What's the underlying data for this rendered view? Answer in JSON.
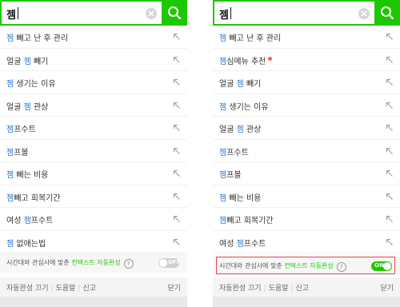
{
  "left": {
    "query": "젬",
    "suggestions": [
      {
        "hl": "젬",
        "rest": " 빼고 난 후 관리"
      },
      {
        "pre": "얼굴 ",
        "hl": "젬",
        "rest": " 빼기"
      },
      {
        "hl": "젬",
        "rest": " 생기는 이유"
      },
      {
        "pre": "얼굴 ",
        "hl": "젬",
        "rest": " 관상"
      },
      {
        "hl": "젬",
        "rest": "프수트"
      },
      {
        "hl": "젬",
        "rest": "프볼"
      },
      {
        "hl": "젬",
        "rest": " 빼는 비용"
      },
      {
        "hl": "젬",
        "rest": "빼고 회복기간"
      },
      {
        "pre": "여성 ",
        "hl": "젬",
        "rest": "프수트"
      },
      {
        "hl": "젬",
        "rest": " 없애는법"
      }
    ],
    "context": {
      "pre": "시간대와 관심사에 맞춘 ",
      "green": "컨텍스트 자동완성",
      "help": "?",
      "toggle": "OFF"
    },
    "footer": {
      "link1": "자동완성 끄기",
      "link2": "도움말",
      "link3": "신고",
      "close": "닫기"
    }
  },
  "right": {
    "query": "젬",
    "suggestions": [
      {
        "hl": "젬",
        "rest": " 빼고 난 후 관리"
      },
      {
        "hl": "젬",
        "rest": "심메뉴 추천",
        "dot": true
      },
      {
        "pre": "얼굴 ",
        "hl": "젬",
        "rest": " 빼기"
      },
      {
        "hl": "젬",
        "rest": " 생기는 이유"
      },
      {
        "pre": "얼굴 ",
        "hl": "젬",
        "rest": " 관상"
      },
      {
        "hl": "젬",
        "rest": "프수트"
      },
      {
        "hl": "젬",
        "rest": "프볼"
      },
      {
        "hl": "젬",
        "rest": " 빼는 비용"
      },
      {
        "hl": "젬",
        "rest": "빼고 회복기간"
      },
      {
        "pre": "여성 ",
        "hl": "젬",
        "rest": "프수트"
      }
    ],
    "context": {
      "pre": "시간대와 관심사에 맞춘 ",
      "green": "컨텍스트 자동완성",
      "help": "?",
      "toggle": "ON"
    },
    "footer": {
      "link1": "자동완성 끄기",
      "link2": "도움말",
      "link3": "신고",
      "close": "닫기"
    }
  },
  "colors": {
    "accent": "#1ec800",
    "highlight": "#2b7bd8",
    "toggle_off": "#cfcfcf",
    "outline": "#e64646"
  }
}
